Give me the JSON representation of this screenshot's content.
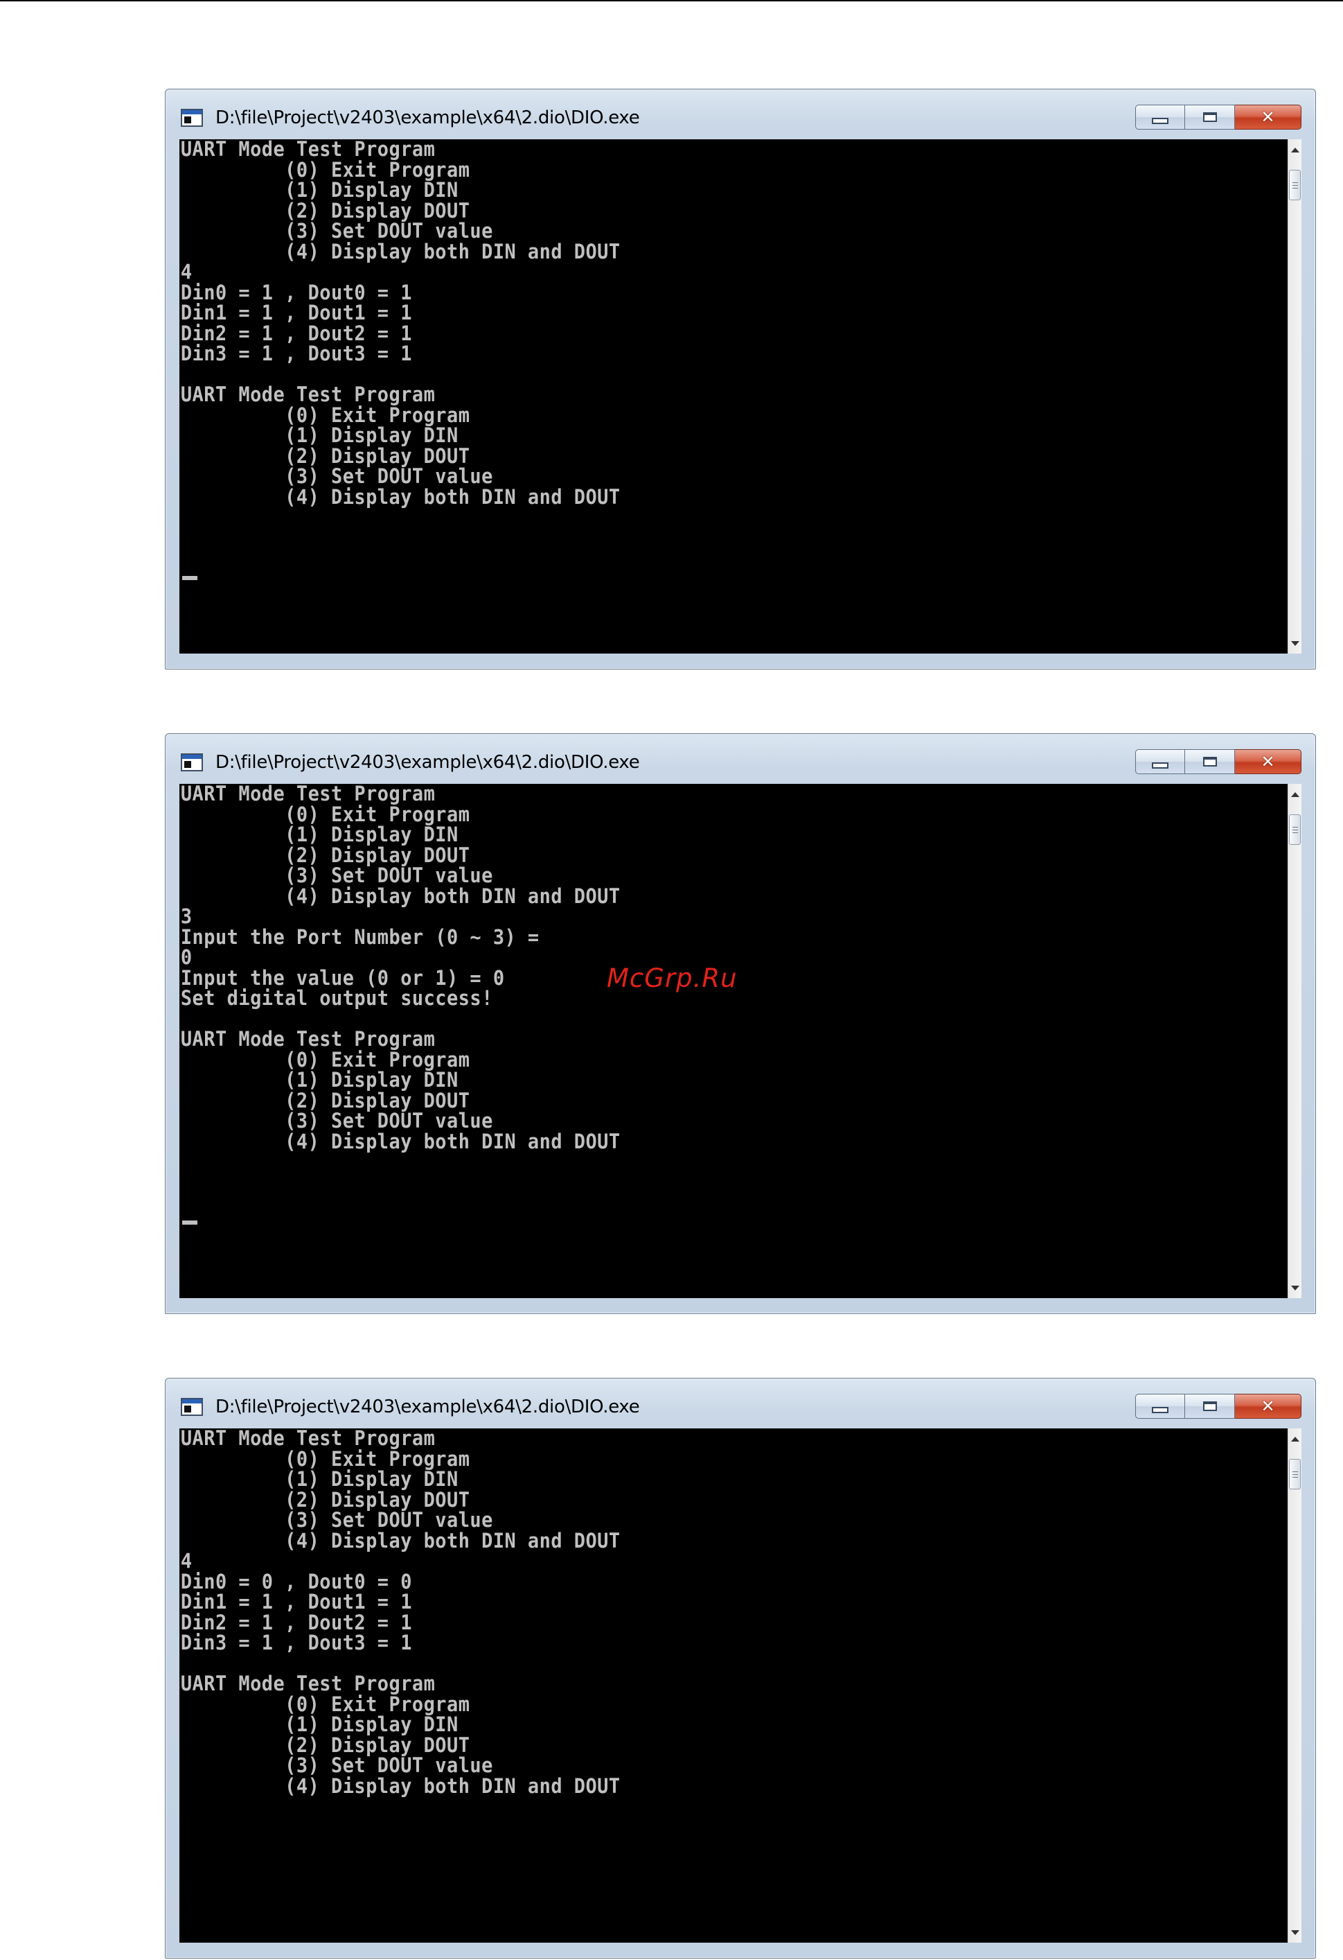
{
  "watermark": "McGrp.Ru",
  "colors": {
    "console_bg": "#000000",
    "console_text": "#c0c0c0",
    "watermark": "#e2231a",
    "close_button": "#c23b1f"
  },
  "windows": [
    {
      "title": "D:\\file\\Project\\v2403\\example\\x64\\2.dio\\DIO.exe",
      "icon": "console-window-icon",
      "controls": {
        "minimize": "minimize-icon",
        "maximize": "maximize-icon",
        "close": "✕"
      },
      "console_text": "UART Mode Test Program\n         (0) Exit Program\n         (1) Display DIN\n         (2) Display DOUT\n         (3) Set DOUT value\n         (4) Display both DIN and DOUT\n4\nDin0 = 1 , Dout0 = 1\nDin1 = 1 , Dout1 = 1\nDin2 = 1 , Dout2 = 1\nDin3 = 1 , Dout3 = 1\n\nUART Mode Test Program\n         (0) Exit Program\n         (1) Display DIN\n         (2) Display DOUT\n         (3) Set DOUT value\n         (4) Display both DIN and DOUT"
    },
    {
      "title": "D:\\file\\Project\\v2403\\example\\x64\\2.dio\\DIO.exe",
      "icon": "console-window-icon",
      "controls": {
        "minimize": "minimize-icon",
        "maximize": "maximize-icon",
        "close": "✕"
      },
      "console_text": "UART Mode Test Program\n         (0) Exit Program\n         (1) Display DIN\n         (2) Display DOUT\n         (3) Set DOUT value\n         (4) Display both DIN and DOUT\n3\nInput the Port Number (0 ~ 3) =\n0\nInput the value (0 or 1) = 0\nSet digital output success!\n\nUART Mode Test Program\n         (0) Exit Program\n         (1) Display DIN\n         (2) Display DOUT\n         (3) Set DOUT value\n         (4) Display both DIN and DOUT"
    },
    {
      "title": "D:\\file\\Project\\v2403\\example\\x64\\2.dio\\DIO.exe",
      "icon": "console-window-icon",
      "controls": {
        "minimize": "minimize-icon",
        "maximize": "maximize-icon",
        "close": "✕"
      },
      "console_text": "UART Mode Test Program\n         (0) Exit Program\n         (1) Display DIN\n         (2) Display DOUT\n         (3) Set DOUT value\n         (4) Display both DIN and DOUT\n4\nDin0 = 0 , Dout0 = 0\nDin1 = 1 , Dout1 = 1\nDin2 = 1 , Dout2 = 1\nDin3 = 1 , Dout3 = 1\n\nUART Mode Test Program\n         (0) Exit Program\n         (1) Display DIN\n         (2) Display DOUT\n         (3) Set DOUT value\n         (4) Display both DIN and DOUT"
    }
  ]
}
